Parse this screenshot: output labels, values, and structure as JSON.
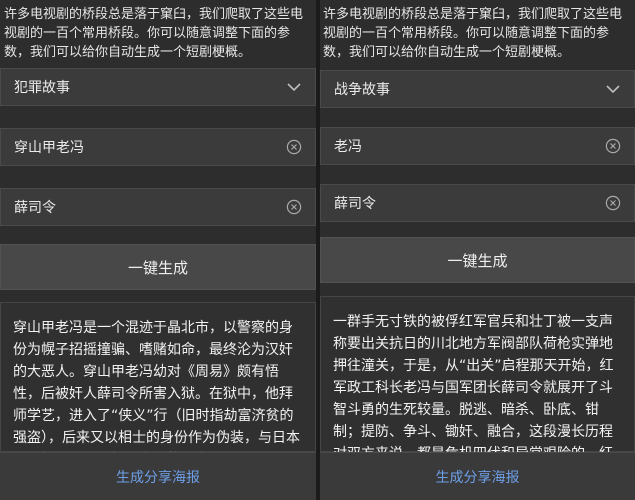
{
  "left": {
    "intro": "许多电视剧的桥段总是落于窠臼，我们爬取了这些电视剧的一百个常用桥段。你可以随意调整下面的参数，我们可以给你自动生成一个短剧梗概。",
    "genre": "犯罪故事",
    "protagonist": "穿山甲老冯",
    "antagonist": "薛司令",
    "generate_label": "一键生成",
    "result": "穿山甲老冯是一个混迹于晶北市，以警察的身份为幌子招摇撞骗、嗜赌如命，最终沦为汉奸的大恶人。穿山甲老冯幼对《周易》颇有悟性，后被奸人薛司令所害入狱。在狱中，他拜师学艺，进入了“侠义”行（旧时指劫富济贫的强盗），后来又以相士的身份作为伪装，与日本人斗智斗勇，保护了中国的国宝。",
    "share_label": "生成分享海报"
  },
  "right": {
    "intro": "许多电视剧的桥段总是落于窠臼，我们爬取了这些电视剧的一百个常用桥段。你可以随意调整下面的参数，我们可以给你自动生成一个短剧梗概。",
    "genre": "战争故事",
    "protagonist": "老冯",
    "antagonist": "薛司令",
    "generate_label": "一键生成",
    "result": "一群手无寸铁的被俘红军官兵和壮丁被一支声称要出关抗日的川北地方军阀部队荷枪实弹地押往潼关，于是，从“出关”启程那天开始，红军政工科长老冯与国军团长薛司令就展开了斗智斗勇的生死较量。脱逃、暗杀、卧底、钳制；提防、争斗、锄奸、融合，这段漫长历程对双方来说，都是危机四伏和异常艰险的。红军官兵恪守信仰，以精神和智慧突围，与敌智斗，攻破敌心……",
    "share_label": "生成分享海报"
  },
  "colors": {
    "panel_bg": "#2d2d2d",
    "field_bg": "#3b3b3b",
    "button_bg": "#484848",
    "link_blue": "#6d9fe8"
  },
  "icons": {
    "dropdown": "chevron-down-icon",
    "clear": "clear-circle-x-icon"
  }
}
